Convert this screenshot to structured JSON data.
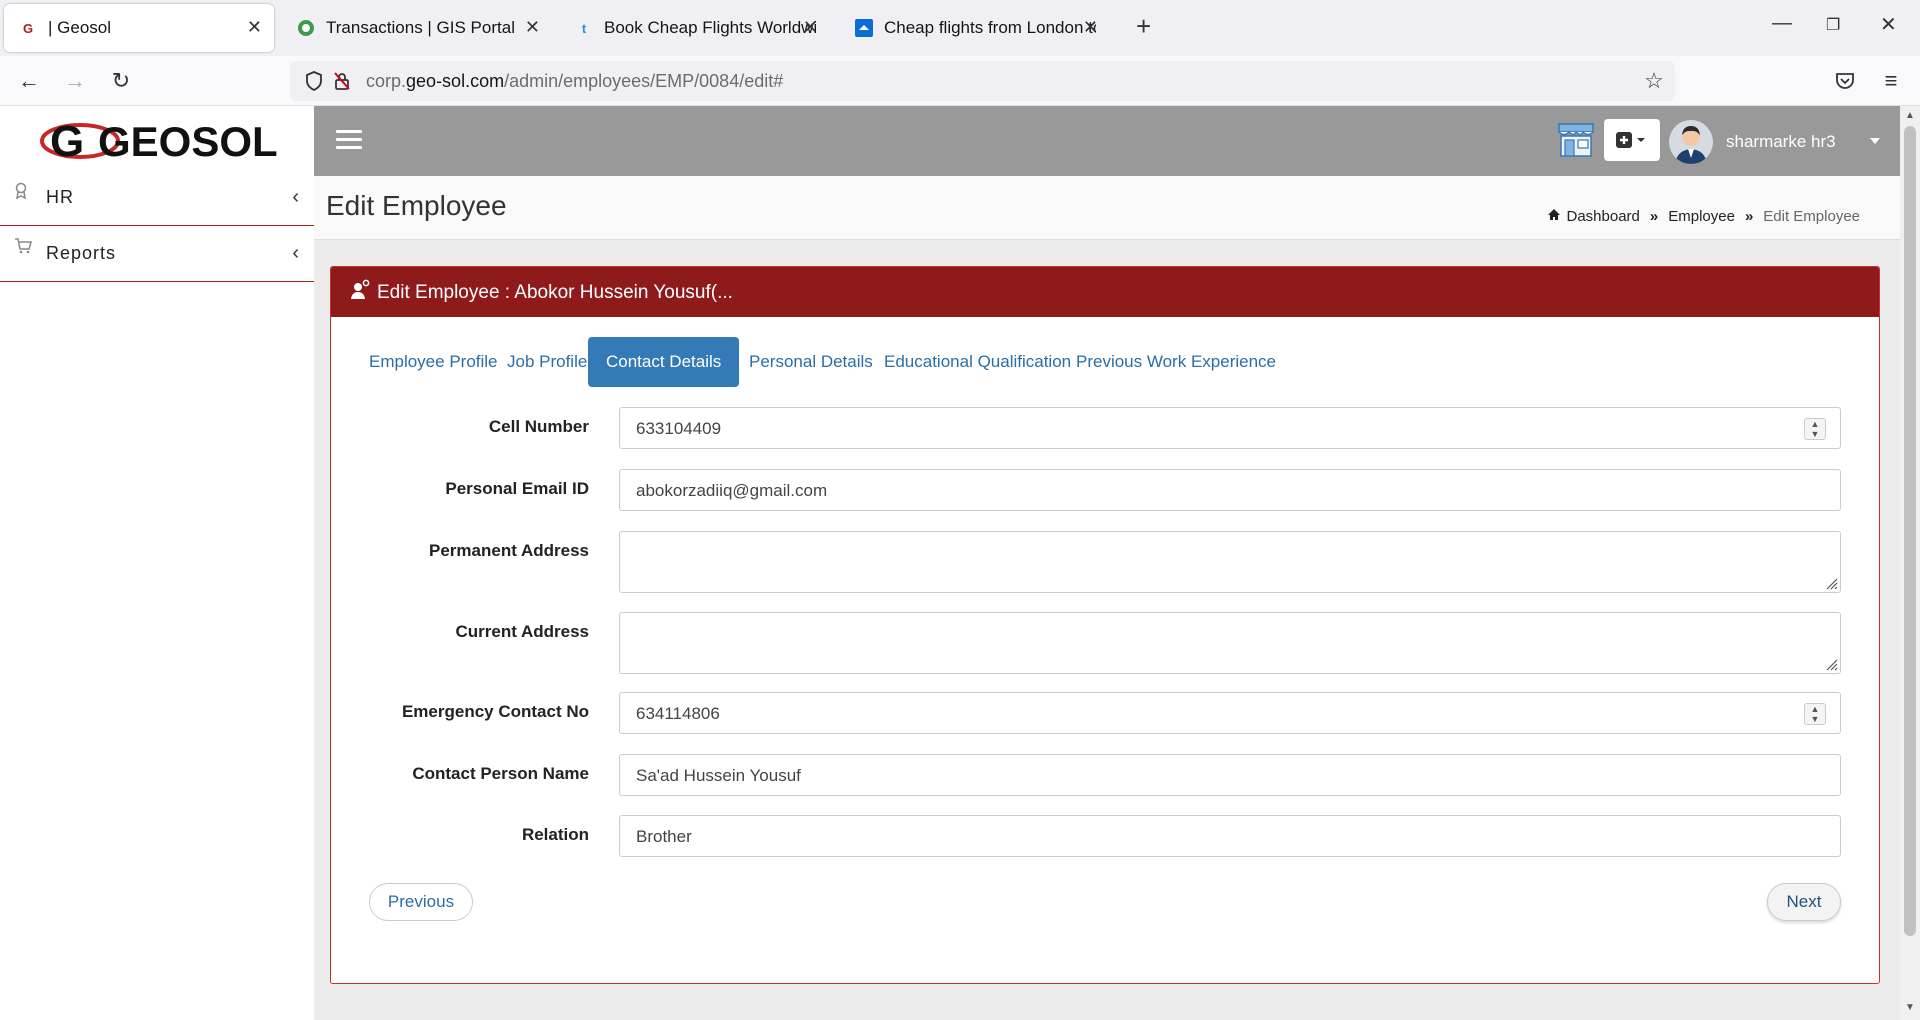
{
  "browser": {
    "tabs": [
      {
        "title": "| Geosol",
        "favicon": "geosol-icon",
        "active": true
      },
      {
        "title": "Transactions | GIS Portal",
        "favicon": "gis-portal-icon",
        "active": false
      },
      {
        "title": "Book Cheap Flights Worldwide",
        "favicon": "travelup-icon",
        "active": false
      },
      {
        "title": "Cheap flights from London to H",
        "favicon": "flights-icon",
        "active": false
      }
    ],
    "url_prefix": "corp.",
    "url_domain": "geo-sol.com",
    "url_path": "/admin/employees/EMP/0084/edit#"
  },
  "sidebar": {
    "logo_text": "GEOSOL",
    "items": [
      {
        "label": "HR",
        "icon": "award-icon"
      },
      {
        "label": "Reports",
        "icon": "cart-icon"
      }
    ]
  },
  "topbar": {
    "user_name": "sharmarke hr3"
  },
  "page": {
    "title": "Edit Employee",
    "breadcrumb": [
      {
        "label": "Dashboard"
      },
      {
        "label": "Employee"
      },
      {
        "label": "Edit Employee"
      }
    ]
  },
  "panel": {
    "title": "Edit Employee : Abokor Hussein Yousuf(...",
    "tabs": [
      {
        "label": "Employee Profile",
        "active": false
      },
      {
        "label": "Job Profile",
        "active": false
      },
      {
        "label": "Contact Details",
        "active": true
      },
      {
        "label": "Personal Details",
        "active": false
      },
      {
        "label": "Educational Qualification",
        "active": false
      },
      {
        "label": "Previous Work Experience",
        "active": false
      }
    ],
    "fields": {
      "cell_number": {
        "label": "Cell Number",
        "value": "633104409"
      },
      "personal_email": {
        "label": "Personal Email ID",
        "value": "abokorzadiiq@gmail.com"
      },
      "permanent_address": {
        "label": "Permanent Address",
        "value": ""
      },
      "current_address": {
        "label": "Current Address",
        "value": ""
      },
      "emergency_contact": {
        "label": "Emergency Contact No",
        "value": "634114806"
      },
      "contact_person": {
        "label": "Contact Person Name",
        "value": "Sa'ad Hussein Yousuf"
      },
      "relation": {
        "label": "Relation",
        "value": "Brother"
      }
    },
    "previous_label": "Previous",
    "next_label": "Next"
  },
  "colors": {
    "panel_header": "#8e1a1c",
    "topbar": "#999999",
    "active_tab": "#337ab7",
    "link": "#2a6ea8"
  }
}
